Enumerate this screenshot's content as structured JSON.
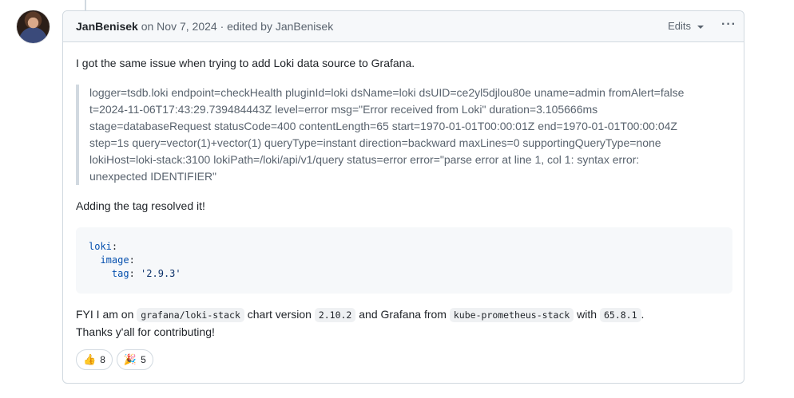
{
  "comment": {
    "author": "JanBenisek",
    "meta": " on Nov 7, 2024 · edited by JanBenisek",
    "edits_label": "Edits",
    "more_icon": "kebab-horizontal-icon",
    "intro": "I got the same issue when trying to add Loki data source to Grafana.",
    "quote_lines": [
      "logger=tsdb.loki endpoint=checkHealth pluginId=loki dsName=loki dsUID=ce2yl5djlou80e uname=admin fromAlert=false",
      "t=2024-11-06T17:43:29.739484443Z level=error msg=\"Error received from Loki\" duration=3.105666ms",
      "stage=databaseRequest statusCode=400 contentLength=65 start=1970-01-01T00:00:01Z end=1970-01-01T00:00:04Z",
      "step=1s query=vector(1)+vector(1) queryType=instant direction=backward maxLines=0 supportingQueryType=none",
      "lokiHost=loki-stack:3100 lokiPath=/loki/api/v1/query status=error error=\"parse error at line 1, col 1: syntax error:",
      "unexpected IDENTIFIER\""
    ],
    "resolved": "Adding the tag resolved it!",
    "code": {
      "l1_key": "loki",
      "l2_key": "image",
      "l3_key": "tag",
      "l3_value": "'2.9.3'"
    },
    "fyi": {
      "t1": "FYI I am on ",
      "c1": "grafana/loki-stack",
      "t2": " chart version ",
      "c2": "2.10.2",
      "t3": " and Grafana from ",
      "c3": "kube-prometheus-stack",
      "t4": " with ",
      "c4": "65.8.1",
      "t5": "."
    },
    "thanks": "Thanks y'all for contributing!",
    "reactions": [
      {
        "emoji": "👍",
        "icon": "thumbs-up-icon",
        "count": "8"
      },
      {
        "emoji": "🎉",
        "icon": "party-popper-icon",
        "count": "5"
      }
    ]
  }
}
